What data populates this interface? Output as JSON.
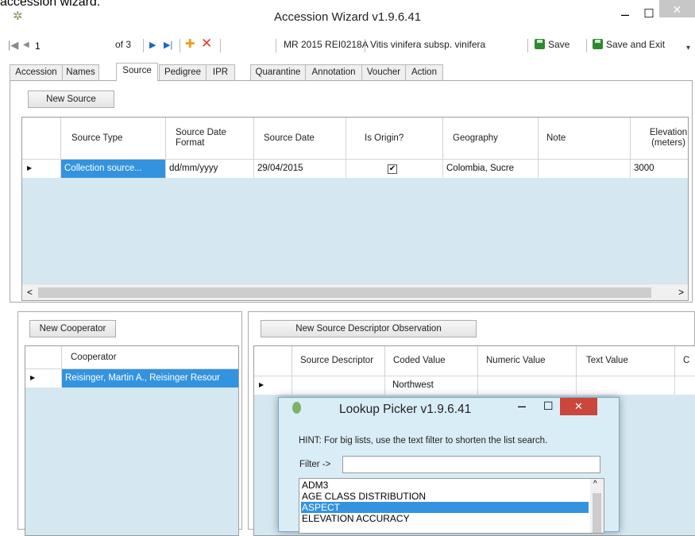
{
  "caption": "accession wizard.",
  "window": {
    "title": "Accession Wizard v1.9.6.41",
    "minimize": "–",
    "maximize": "☐",
    "close": "✕"
  },
  "toolbar": {
    "position": "1",
    "of_total": "of 3",
    "record_label": "MR 2015 REI0218A",
    "taxon_label": "Vitis vinifera subsp. vinifera",
    "save_label": "Save",
    "save_exit_label": "Save and Exit",
    "first_glyph": "|◀",
    "prev_glyph": "◀",
    "next_glyph": "▶",
    "last_glyph": "▶|",
    "add_glyph": "✚",
    "delete_glyph": "✕",
    "overflow_glyph": "▾"
  },
  "tabs": [
    "Accession",
    "Names",
    "Source",
    "Pedigree",
    "IPR",
    "Quarantine",
    "Annotation",
    "Voucher",
    "Action"
  ],
  "active_tab": "Source",
  "source": {
    "new_button": "New Source",
    "columns": [
      "Source Type",
      "Source Date Format",
      "Source Date",
      "Is Origin?",
      "Geography",
      "Note",
      "Elevation (meters)"
    ],
    "row": {
      "pointer": "▶",
      "source_type": "Collection source...",
      "date_format": "dd/mm/yyyy",
      "date": "29/04/2015",
      "is_origin": "✔",
      "geography": "Colombia, Sucre",
      "note": "",
      "elevation": "3000"
    },
    "scroll_left": "<",
    "scroll_right": ">"
  },
  "cooperators": {
    "new_button": "New Cooperator",
    "column": "Cooperator",
    "row": "Reisinger, Martin A., Reisinger Resour",
    "pointer": "▶"
  },
  "descriptors": {
    "new_button": "New Source Descriptor Observation",
    "columns": [
      "Source Descriptor",
      "Coded Value",
      "Numeric Value",
      "Text Value",
      "C"
    ],
    "row_coded_value": "Northwest",
    "pointer": "▶"
  },
  "lookup": {
    "title": "Lookup Picker v1.9.6.41",
    "hint": "HINT: For big lists, use the text filter to shorten the list search.",
    "filter_label": "Filter ->",
    "filter_value": "",
    "items": [
      "ADM3",
      "AGE CLASS DISTRIBUTION",
      "ASPECT",
      "ELEVATION ACCURACY"
    ],
    "selected_item": "ASPECT",
    "scroll_up": "^",
    "minimize": "–",
    "maximize": "☐",
    "close": "✕",
    "colors": {
      "close_bg": "#c9473b",
      "selection": "#3393df",
      "dialog_bg": "#d9edf7"
    }
  }
}
